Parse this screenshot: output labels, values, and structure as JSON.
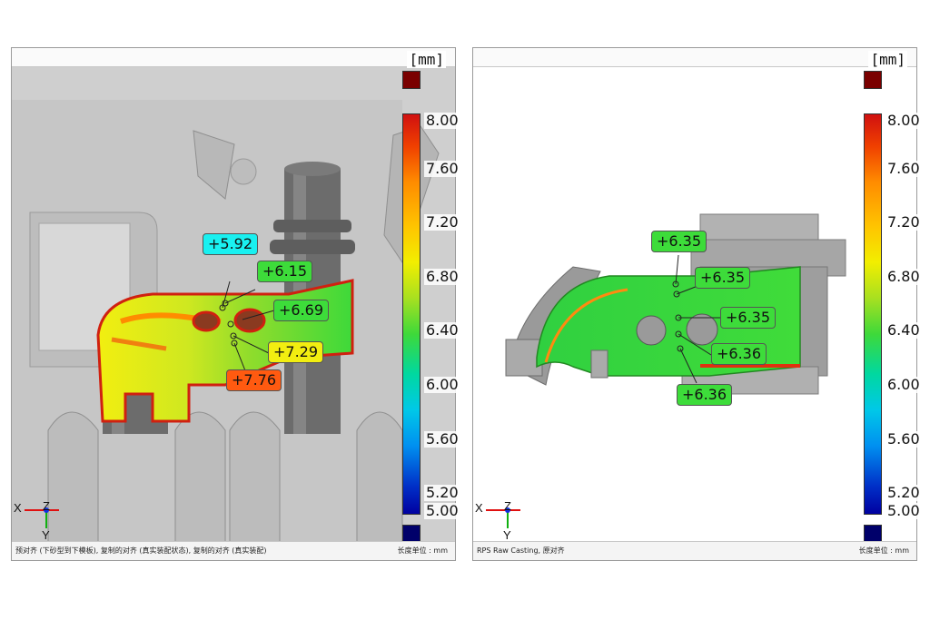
{
  "scale": {
    "unit": "[mm]",
    "ticks": [
      "8.00",
      "7.60",
      "7.20",
      "6.80",
      "6.40",
      "6.00",
      "5.60",
      "5.20",
      "5.00"
    ]
  },
  "colors": {
    "overflow_high": "#7a0000",
    "overflow_low": "#00006a",
    "callout_cyan": "#19f0f0",
    "callout_green": "#3ddc3a",
    "callout_yellow": "#f2ee10",
    "callout_orange": "#ff5a10"
  },
  "left_panel": {
    "callouts": [
      "+5.92",
      "+6.15",
      "+6.69",
      "+7.29",
      "+7.76"
    ],
    "status_left": "预对齐 (下砂型到下模板), 复制的对齐 (真实装配状态), 复制的对齐 (真实装配)",
    "status_right": "长度单位 : mm"
  },
  "right_panel": {
    "callouts": [
      "+6.35",
      "+6.35",
      "+6.35",
      "+6.36",
      "+6.36"
    ],
    "status_left": "RPS Raw Casting, 原对齐",
    "status_right": "长度单位 : mm"
  },
  "axes": {
    "x": "X",
    "y": "Y",
    "z": "Z"
  }
}
